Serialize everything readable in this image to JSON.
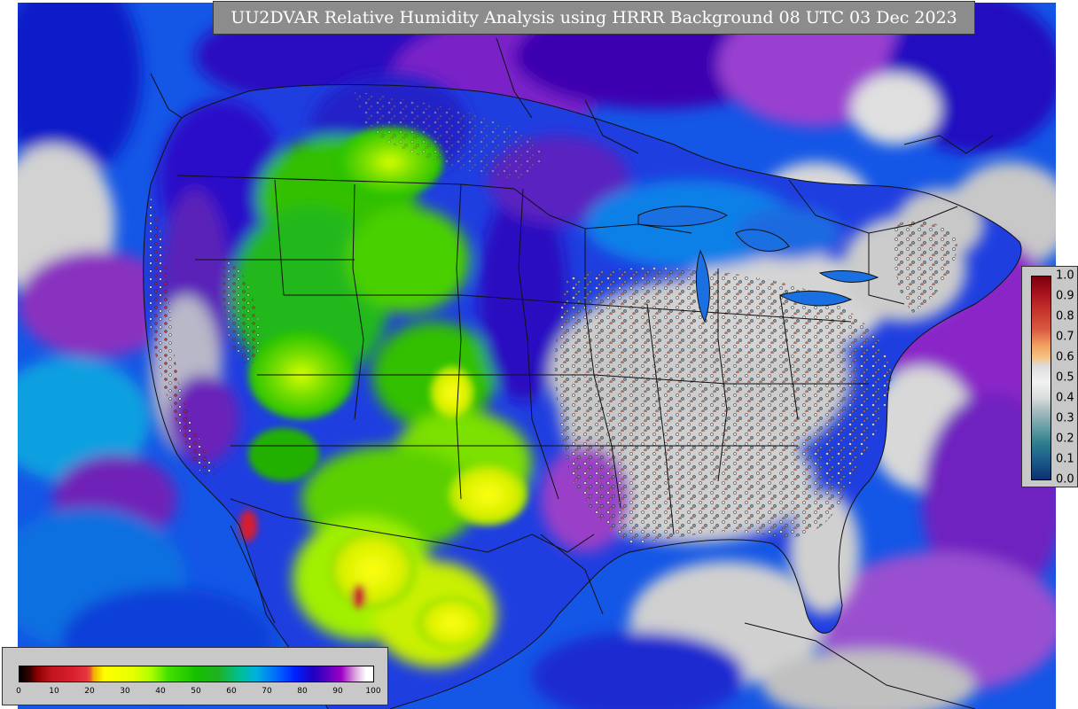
{
  "title": "UU2DVAR Relative Humidity Analysis using HRRR Background 08 UTC 03 Dec 2023",
  "rh_colorbar": {
    "ticks": [
      "0",
      "10",
      "20",
      "30",
      "40",
      "50",
      "60",
      "70",
      "80",
      "90",
      "100"
    ]
  },
  "observation_colorbar": {
    "ticks": [
      "1.0",
      "0.9",
      "0.8",
      "0.7",
      "0.6",
      "0.5",
      "0.4",
      "0.3",
      "0.2",
      "0.1",
      "0.0"
    ]
  }
}
